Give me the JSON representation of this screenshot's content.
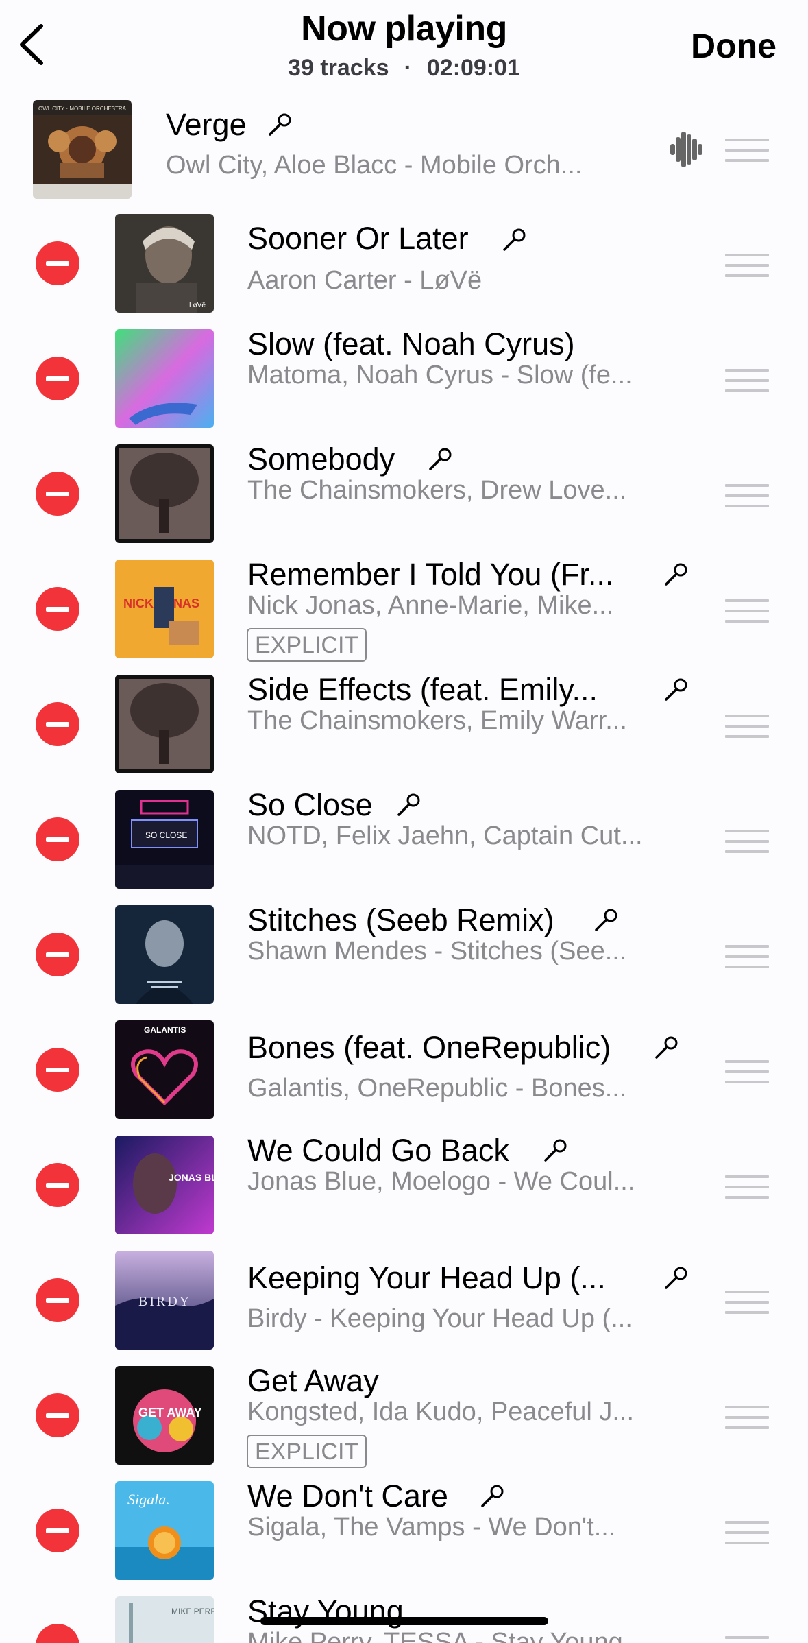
{
  "header": {
    "title": "Now playing",
    "track_count": "39 tracks",
    "separator": "·",
    "duration": "02:09:01",
    "done_label": "Done"
  },
  "current_track": {
    "title": "Verge",
    "subtitle": "Owl City, Aloe Blacc - Mobile Orch...",
    "art_label": "OWL CITY · MOBILE ORCHESTRA"
  },
  "tracks": [
    {
      "title": "Sooner Or Later",
      "subtitle": "Aaron Carter - LøVë",
      "art_label": "LøVë"
    },
    {
      "title": "Slow (feat. Noah Cyrus)",
      "subtitle": "Matoma, Noah Cyrus - Slow (fe..."
    },
    {
      "title": "Somebody",
      "subtitle": "The Chainsmokers, Drew Love..."
    },
    {
      "title": "Remember I Told You (Fr...",
      "subtitle": "Nick Jonas, Anne-Marie, Mike...",
      "badge": "EXPLICIT",
      "art_label": "NICK JONAS"
    },
    {
      "title": "Side Effects (feat. Emily...",
      "subtitle": "The Chainsmokers, Emily Warr..."
    },
    {
      "title": "So Close",
      "subtitle": "NOTD, Felix Jaehn, Captain Cut...",
      "art_label": "SO CLOSE"
    },
    {
      "title": "Stitches (Seeb Remix)",
      "subtitle": "Shawn Mendes - Stitches (See..."
    },
    {
      "title": "Bones (feat. OneRepublic)",
      "subtitle": "Galantis, OneRepublic - Bones...",
      "art_label": "GALANTIS"
    },
    {
      "title": "We Could Go Back",
      "subtitle": "Jonas Blue, Moelogo - We Coul...",
      "art_label": "JONAS BLUE"
    },
    {
      "title": "Keeping Your Head Up (...",
      "subtitle": "Birdy - Keeping Your Head Up (...",
      "art_label": "BIRDY"
    },
    {
      "title": "Get Away",
      "subtitle": "Kongsted, Ida Kudo, Peaceful J...",
      "badge": "EXPLICIT",
      "art_label": "GET AWAY"
    },
    {
      "title": "We Don't Care",
      "subtitle": "Sigala, The Vamps - We Don't...",
      "art_label": "Sigala."
    },
    {
      "title": "Stay Young",
      "subtitle": "Mike Perry, TESSA - Stay Young",
      "art_label": "MIKE PERRY"
    }
  ],
  "colors": {
    "accent_remove": "#f3333a",
    "secondary_text": "#8a8a8e",
    "background": "#fcfcfe",
    "grip": "#c7c7cc"
  },
  "icons": {
    "back": "chevron-left-icon",
    "mic": "microphone-icon",
    "wave": "sound-wave-icon",
    "grip": "drag-handle-icon",
    "remove": "minus-circle-icon"
  }
}
